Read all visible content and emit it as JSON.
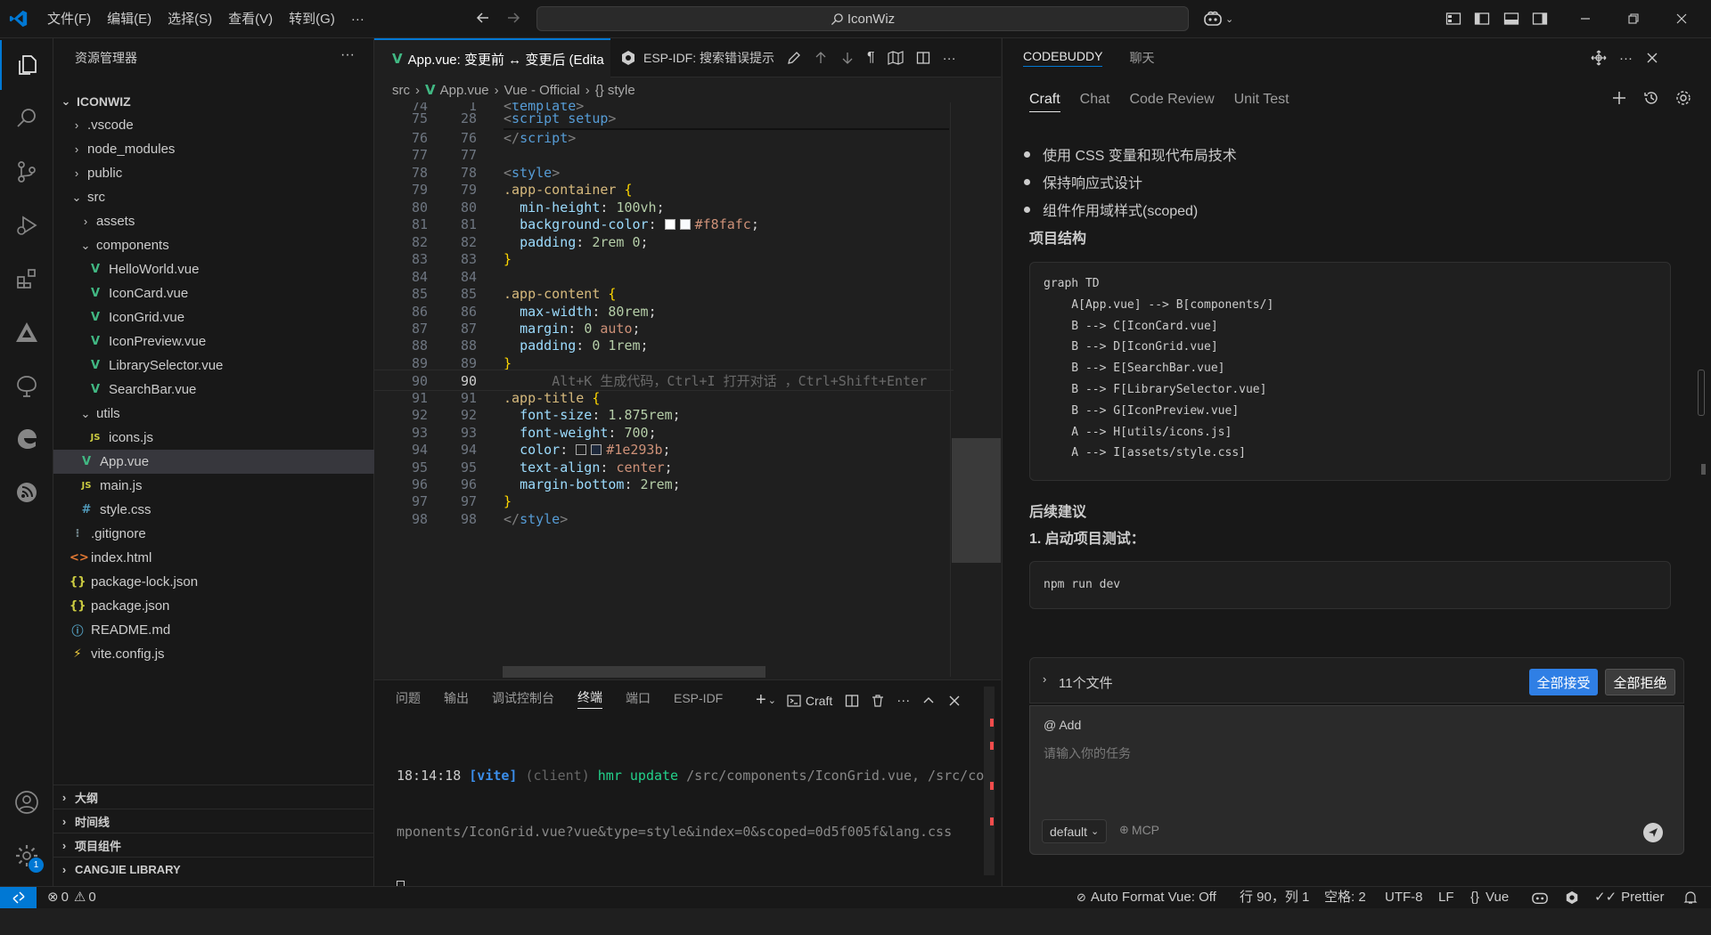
{
  "titlebar": {
    "menus": [
      "文件(F)",
      "编辑(E)",
      "选择(S)",
      "查看(V)",
      "转到(G)",
      "···"
    ],
    "search": "IconWiz"
  },
  "sidebar": {
    "title": "资源管理器",
    "root": "ICONWIZ",
    "tree": [
      {
        "label": ".vscode",
        "kind": "folder-closed",
        "depth": 1
      },
      {
        "label": "node_modules",
        "kind": "folder-closed",
        "depth": 1
      },
      {
        "label": "public",
        "kind": "folder-closed",
        "depth": 1
      },
      {
        "label": "src",
        "kind": "folder-open",
        "depth": 1
      },
      {
        "label": "assets",
        "kind": "folder-closed",
        "depth": 2
      },
      {
        "label": "components",
        "kind": "folder-open",
        "depth": 2
      },
      {
        "label": "HelloWorld.vue",
        "kind": "vue",
        "depth": 3
      },
      {
        "label": "IconCard.vue",
        "kind": "vue",
        "depth": 3
      },
      {
        "label": "IconGrid.vue",
        "kind": "vue",
        "depth": 3
      },
      {
        "label": "IconPreview.vue",
        "kind": "vue",
        "depth": 3
      },
      {
        "label": "LibrarySelector.vue",
        "kind": "vue",
        "depth": 3
      },
      {
        "label": "SearchBar.vue",
        "kind": "vue",
        "depth": 3
      },
      {
        "label": "utils",
        "kind": "folder-open",
        "depth": 2
      },
      {
        "label": "icons.js",
        "kind": "js",
        "depth": 3
      },
      {
        "label": "App.vue",
        "kind": "vue",
        "depth": 2,
        "selected": true
      },
      {
        "label": "main.js",
        "kind": "js",
        "depth": 2
      },
      {
        "label": "style.css",
        "kind": "css",
        "depth": 2
      },
      {
        "label": ".gitignore",
        "kind": "git",
        "depth": 1
      },
      {
        "label": "index.html",
        "kind": "html",
        "depth": 1
      },
      {
        "label": "package-lock.json",
        "kind": "json",
        "depth": 1
      },
      {
        "label": "package.json",
        "kind": "json",
        "depth": 1
      },
      {
        "label": "README.md",
        "kind": "md",
        "depth": 1
      },
      {
        "label": "vite.config.js",
        "kind": "vite",
        "depth": 1
      }
    ],
    "sections": [
      "大纲",
      "时间线",
      "项目组件",
      "CANGJIE LIBRARY"
    ]
  },
  "editor": {
    "tab": "App.vue: 变更前 ↔ 变更后 (Edita",
    "toolbar_label": "ESP-IDF: 搜索错误提示",
    "breadcrumb": [
      "src",
      "App.vue",
      "Vue - Official",
      "{} style"
    ],
    "lines": [
      {
        "l": "74",
        "r": "1",
        "html": "<span class=\"tag\">&lt;</span><span class=\"tn\">template</span><span class=\"tag\">&gt;</span>"
      },
      {
        "l": "75",
        "r": "28",
        "html": "<span class=\"tag\">&lt;</span><span class=\"tn\">script setup</span><span class=\"tag\">&gt;</span>"
      },
      {
        "l": "76",
        "r": "76",
        "html": "<span class=\"tag\">&lt;/</span><span class=\"tn\">script</span><span class=\"tag\">&gt;</span>"
      },
      {
        "l": "77",
        "r": "77",
        "html": ""
      },
      {
        "l": "78",
        "r": "78",
        "html": "<span class=\"tag\">&lt;</span><span class=\"tn\">style</span><span class=\"tag\">&gt;</span>"
      },
      {
        "l": "79",
        "r": "79",
        "html": "<span class=\"sel-c\">.app-container</span> <span class=\"br\">{</span>"
      },
      {
        "l": "80",
        "r": "80",
        "html": "  <span class=\"pr\">min-height</span><span class=\"pl\">:</span> <span class=\"nu\">100vh</span><span class=\"pl\">;</span>"
      },
      {
        "l": "81",
        "r": "81",
        "html": "  <span class=\"pr\">background-color</span><span class=\"pl\">:</span> <span class=\"sw\" style=\"background:#fff\"></span><span class=\"sw\" style=\"background:#f8fafc\"></span><span class=\"kw\">#f8fafc</span><span class=\"pl\">;</span>"
      },
      {
        "l": "82",
        "r": "82",
        "html": "  <span class=\"pr\">padding</span><span class=\"pl\">:</span> <span class=\"nu\">2rem</span> <span class=\"nu\">0</span><span class=\"pl\">;</span>"
      },
      {
        "l": "83",
        "r": "83",
        "html": "<span class=\"br\">}</span>"
      },
      {
        "l": "84",
        "r": "84",
        "html": ""
      },
      {
        "l": "85",
        "r": "85",
        "html": "<span class=\"sel-c\">.app-content</span> <span class=\"br\">{</span>"
      },
      {
        "l": "86",
        "r": "86",
        "html": "  <span class=\"pr\">max-width</span><span class=\"pl\">:</span> <span class=\"nu\">80rem</span><span class=\"pl\">;</span>"
      },
      {
        "l": "87",
        "r": "87",
        "html": "  <span class=\"pr\">margin</span><span class=\"pl\">:</span> <span class=\"nu\">0</span> <span class=\"kw\">auto</span><span class=\"pl\">;</span>"
      },
      {
        "l": "88",
        "r": "88",
        "html": "  <span class=\"pr\">padding</span><span class=\"pl\">:</span> <span class=\"nu\">0</span> <span class=\"nu\">1rem</span><span class=\"pl\">;</span>"
      },
      {
        "l": "89",
        "r": "89",
        "html": "<span class=\"br\">}</span>"
      },
      {
        "l": "90",
        "r": "90",
        "html": "      <span style=\"color:#6a6a6a\">Alt+K 生成代码，Ctrl+I 打开对话 ，Ctrl+Shift+Enter</span>",
        "current": true
      },
      {
        "l": "91",
        "r": "91",
        "html": "<span class=\"sel-c\">.app-title</span> <span class=\"br\">{</span>"
      },
      {
        "l": "92",
        "r": "92",
        "html": "  <span class=\"pr\">font-size</span><span class=\"pl\">:</span> <span class=\"nu\">1.875rem</span><span class=\"pl\">;</span>"
      },
      {
        "l": "93",
        "r": "93",
        "html": "  <span class=\"pr\">font-weight</span><span class=\"pl\">:</span> <span class=\"nu\">700</span><span class=\"pl\">;</span>"
      },
      {
        "l": "94",
        "r": "94",
        "html": "  <span class=\"pr\">color</span><span class=\"pl\">:</span> <span class=\"sw\" style=\"background:#1f1f1f\"></span><span class=\"sw\" style=\"background:#1e293b\"></span><span class=\"kw\">#1e293b</span><span class=\"pl\">;</span>"
      },
      {
        "l": "95",
        "r": "95",
        "html": "  <span class=\"pr\">text-align</span><span class=\"pl\">:</span> <span class=\"kw\">center</span><span class=\"pl\">;</span>"
      },
      {
        "l": "96",
        "r": "96",
        "html": "  <span class=\"pr\">margin-bottom</span><span class=\"pl\">:</span> <span class=\"nu\">2rem</span><span class=\"pl\">;</span>"
      },
      {
        "l": "97",
        "r": "97",
        "html": "<span class=\"br\">}</span>"
      },
      {
        "l": "98",
        "r": "98",
        "html": "<span class=\"tag\">&lt;/</span><span class=\"tn\">style</span><span class=\"tag\">&gt;</span>"
      }
    ]
  },
  "panel": {
    "tabs": [
      "问题",
      "输出",
      "调试控制台",
      "终端",
      "端口",
      "ESP-IDF"
    ],
    "active_tab": "终端",
    "craft_label": "Craft",
    "term_time": "18:14:18",
    "term_vite": "[vite]",
    "term_client": "(client)",
    "term_hmr": "hmr update",
    "term_path1": "/src/components/IconGrid.vue, /src/co",
    "term_line2": "mponents/IconGrid.vue?vue&type=style&index=0&scoped=0d5f005f&lang.css"
  },
  "right": {
    "header_tabs": [
      "CODEBUDDY",
      "聊天"
    ],
    "mode_tabs": [
      "Craft",
      "Chat",
      "Code Review",
      "Unit Test"
    ],
    "bullets": [
      "使用 CSS 变量和现代布局技术",
      "保持响应式设计",
      "组件作用域样式(scoped)"
    ],
    "structure_title": "项目结构",
    "graph_lines": [
      "graph TD",
      "    A[App.vue] --> B[components/]",
      "    B --> C[IconCard.vue]",
      "    B --> D[IconGrid.vue]",
      "    B --> E[SearchBar.vue]",
      "    B --> F[LibrarySelector.vue]",
      "    B --> G[IconPreview.vue]",
      "    A --> H[utils/icons.js]",
      "    A --> I[assets/style.css]"
    ],
    "next_title": "后续建议",
    "step1": "1. 启动项目测试：",
    "cmd": "npm run dev",
    "files_count": "11个文件",
    "accept_all": "全部接受",
    "reject_all": "全部拒绝",
    "add_label": "@ Add",
    "input_placeholder": "请输入你的任务",
    "model": "default",
    "mcp": "MCP"
  },
  "status": {
    "errors": "0",
    "warnings": "0",
    "auto_format": "Auto Format Vue: Off",
    "position": "行 90，列 1",
    "spaces": "空格: 2",
    "encoding": "UTF-8",
    "eol": "LF",
    "language": "Vue",
    "prettier": "Prettier"
  },
  "colors": {
    "accent": "#0078d4",
    "vue": "#41b883",
    "accept": "#0e639c"
  }
}
